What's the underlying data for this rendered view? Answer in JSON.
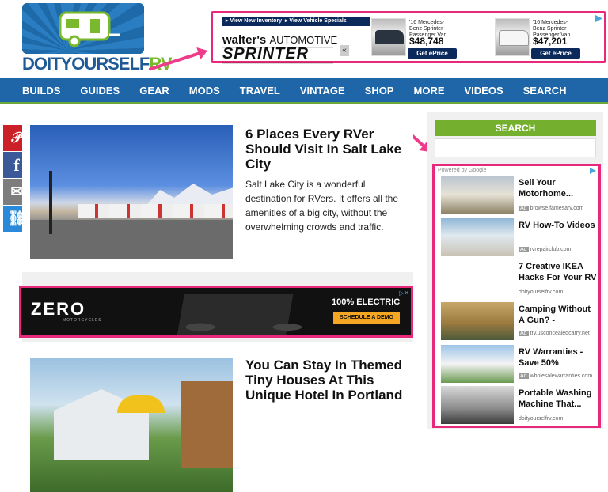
{
  "logo": {
    "text_a": "DOITYOURSELF",
    "text_b": "RV"
  },
  "top_ad": {
    "bar_links": [
      "▸ View New Inventory",
      "▸ View Vehicle Specials"
    ],
    "dealer_a": "walter's",
    "dealer_b": "AUTOMOTIVE",
    "brand": "SPRINTER",
    "nav_prev": "«",
    "vans": [
      {
        "name": "'16 Mercedes-Benz Sprinter Passenger Van",
        "price": "$48,748",
        "cta": "Get ePrice"
      },
      {
        "name": "'16 Mercedes-Benz Sprinter Passenger Van",
        "price": "$47,201",
        "cta": "Get ePrice"
      }
    ],
    "partial_van_name": "'16 Mercedes-Benz Sprinter Passenger Van"
  },
  "nav": {
    "items": [
      "BUILDS",
      "GUIDES",
      "GEAR",
      "MODS",
      "TRAVEL",
      "VINTAGE",
      "SHOP",
      "MORE",
      "VIDEOS",
      "SEARCH"
    ]
  },
  "share": [
    {
      "icon": "pinterest-icon",
      "glyph": "𝒫",
      "color": "#cb2027"
    },
    {
      "icon": "facebook-icon",
      "glyph": "f",
      "color": "#3b5998"
    },
    {
      "icon": "email-icon",
      "glyph": "✉",
      "color": "#7d7d7d"
    },
    {
      "icon": "link-icon",
      "glyph": "⛓",
      "color": "#2a89d8"
    }
  ],
  "articles": [
    {
      "title": "6 Places Every RVer Should Visit In Salt Lake City",
      "excerpt": "Salt Lake City is a wonderful destination for RVers. It offers all the amenities of a big city, without the overwhelming crowds and traffic."
    },
    {
      "title": "You Can Stay In Themed Tiny Houses At This Unique Hotel In Portland",
      "excerpt": ""
    }
  ],
  "zero_ad": {
    "logo": "ZERO",
    "sub": "MOTORCYCLES",
    "headline": "100% ELECTRIC",
    "cta": "SCHEDULE A DEMO"
  },
  "sidebar": {
    "search_heading": "SEARCH",
    "powered_by": "Powered by Google",
    "ads": [
      {
        "headline": "Sell Your Motorhome...",
        "source": "browse.famesarv.com",
        "ad": true
      },
      {
        "headline": "RV How-To Videos",
        "source": "rvrepairclub.com",
        "ad": true
      },
      {
        "headline": "7 Creative IKEA Hacks For Your RV",
        "source": "doityourselfrv.com",
        "ad": false
      },
      {
        "headline": "Camping Without A Gun? -",
        "source": "try.usconcealedcarry.net",
        "ad": true
      },
      {
        "headline": "RV Warranties - Save 50%",
        "source": "wholesalewarranties.com",
        "ad": true
      },
      {
        "headline": "Portable Washing Machine That...",
        "source": "doityourselfrv.com",
        "ad": false
      }
    ],
    "ad_badge": "Ad"
  },
  "colors": {
    "accent_pink": "#e8287a",
    "nav_blue": "#1e66a8",
    "green": "#74b02e"
  }
}
